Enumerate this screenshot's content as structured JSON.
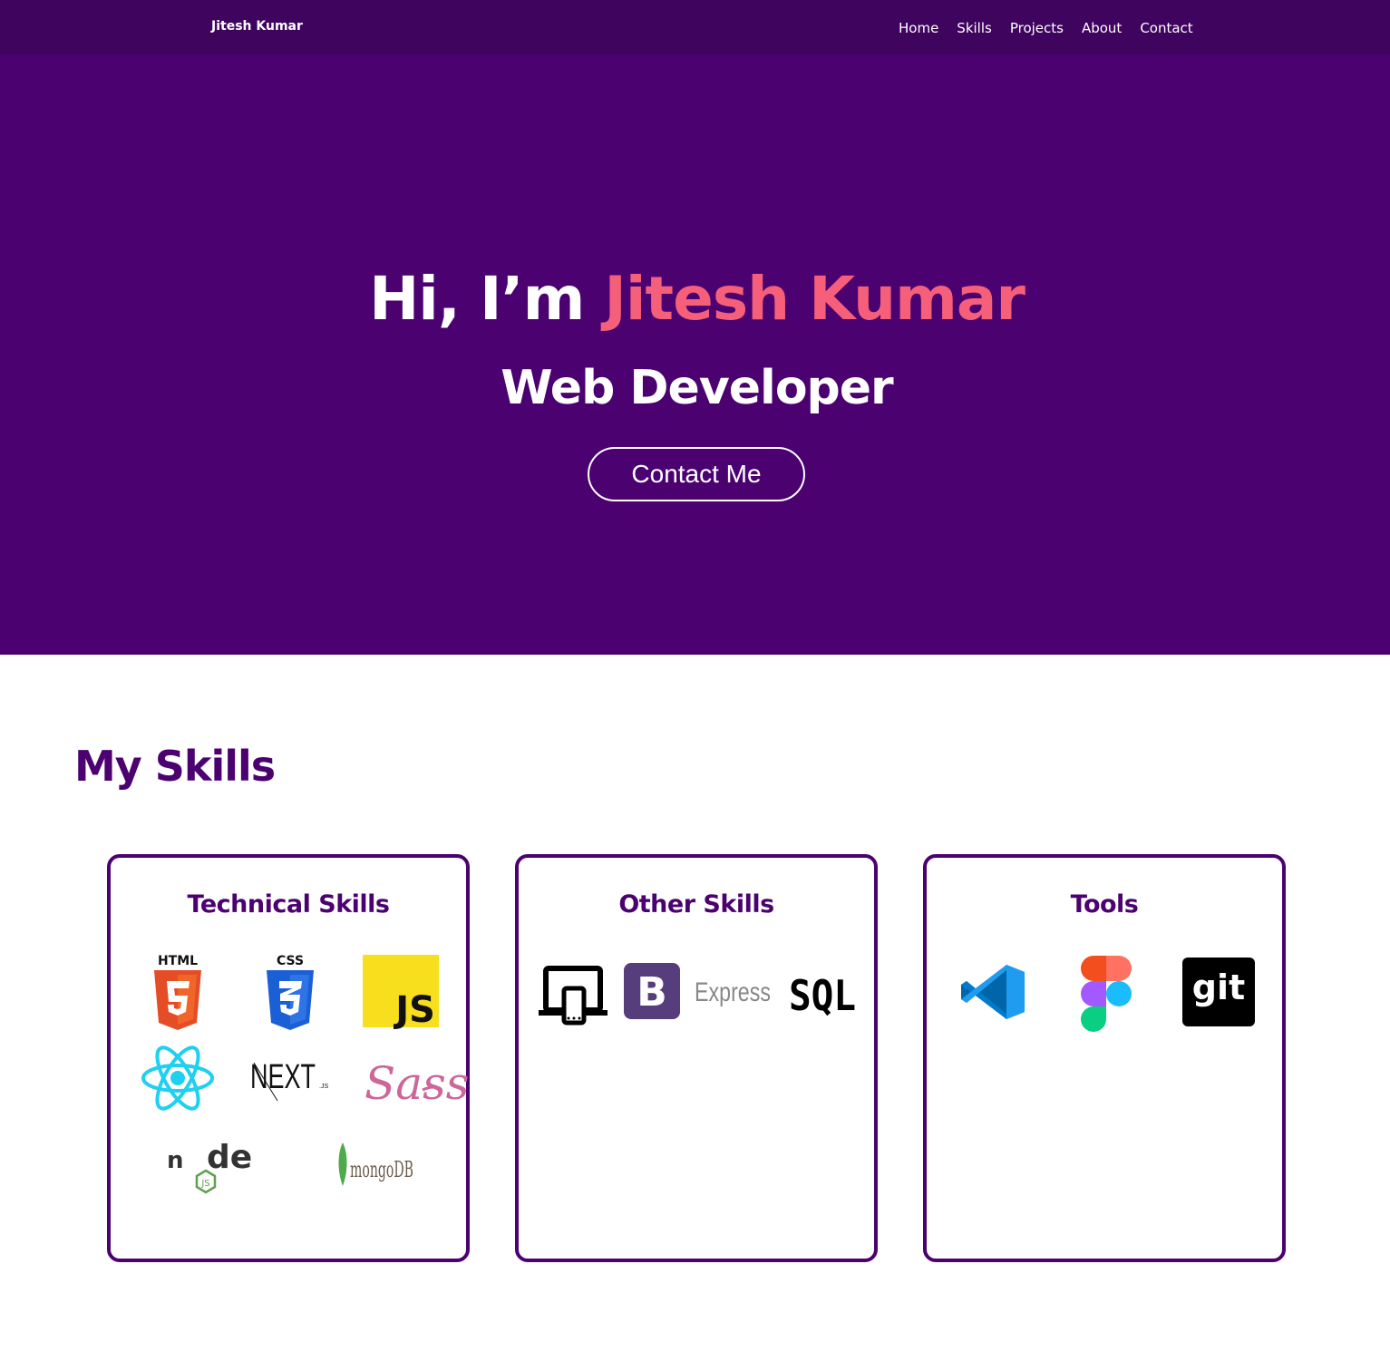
{
  "navbar": {
    "brand": "Jitesh Kumar",
    "links": [
      "Home",
      "Skills",
      "Projects",
      "About",
      "Contact"
    ]
  },
  "hero": {
    "greeting": "Hi, I’m",
    "name": "Jitesh Kumar",
    "role": "Web Developer",
    "cta_label": "Contact Me"
  },
  "skills": {
    "title": "My Skills",
    "cards": [
      {
        "title": "Technical Skills",
        "icons": [
          "html5-icon",
          "css3-icon",
          "javascript-icon",
          "react-icon",
          "nextjs-icon",
          "sass-icon",
          "nodejs-icon",
          "mongodb-icon"
        ],
        "logo_text": {
          "html": "HTML",
          "css": "CSS",
          "js": "JS",
          "next": "NEXT",
          "next_suffix": ".JS",
          "sass": "Sass",
          "node_n": "n",
          "node_de": "de",
          "node_js": "JS",
          "mongo": "mongoDB"
        }
      },
      {
        "title": "Other Skills",
        "icons": [
          "responsive-design-icon",
          "bootstrap-icon",
          "express-icon",
          "sql-icon"
        ],
        "logo_text": {
          "bootstrap": "B",
          "express": "Express",
          "sql": "SQL"
        }
      },
      {
        "title": "Tools",
        "icons": [
          "vscode-icon",
          "figma-icon",
          "git-icon"
        ],
        "logo_text": {
          "git": "git"
        }
      }
    ]
  },
  "colors": {
    "navbar": "#3e045e",
    "hero": "#4b0270",
    "accent": "#f65f7a",
    "heading": "#4b0270"
  }
}
